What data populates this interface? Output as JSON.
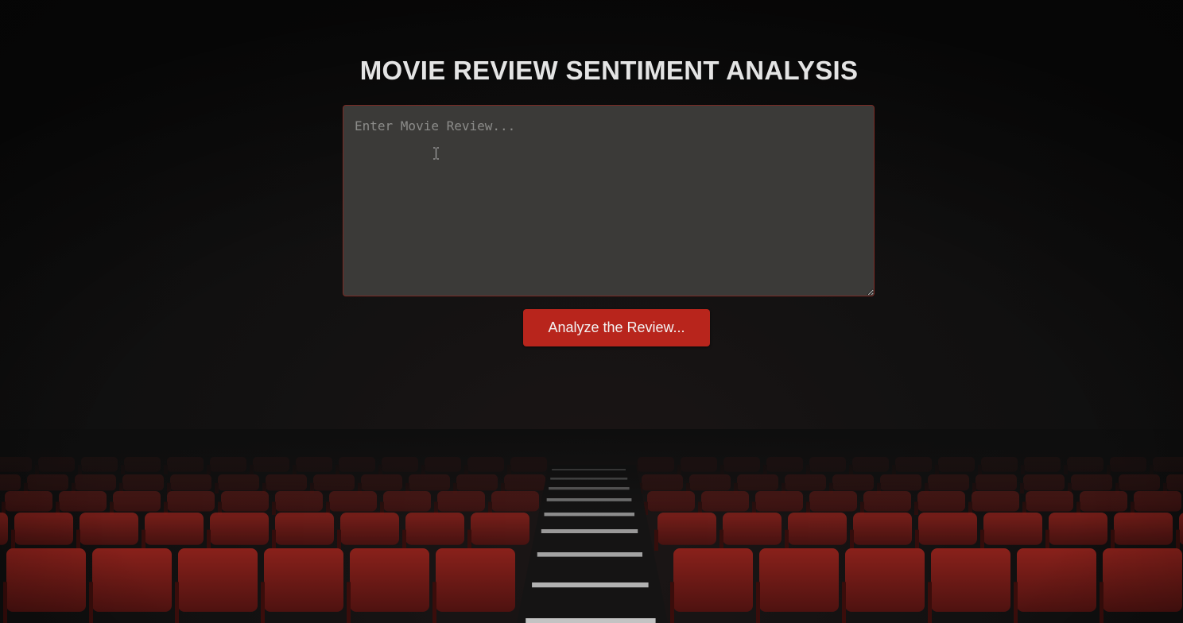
{
  "page": {
    "title": "MOVIE REVIEW SENTIMENT ANALYSIS"
  },
  "review": {
    "placeholder": "Enter Movie Review...",
    "value": ""
  },
  "analyze_button": {
    "label": "Analyze the Review..."
  },
  "colors": {
    "background": "#0f0f0f",
    "accent_red": "#b8251c",
    "textarea_bg": "#3b3a38",
    "textarea_border": "#7a2a24",
    "title_text": "#e4e4e4",
    "seat_red": "#7a1c18"
  },
  "icons": {
    "cursor": "text-cursor-icon"
  }
}
